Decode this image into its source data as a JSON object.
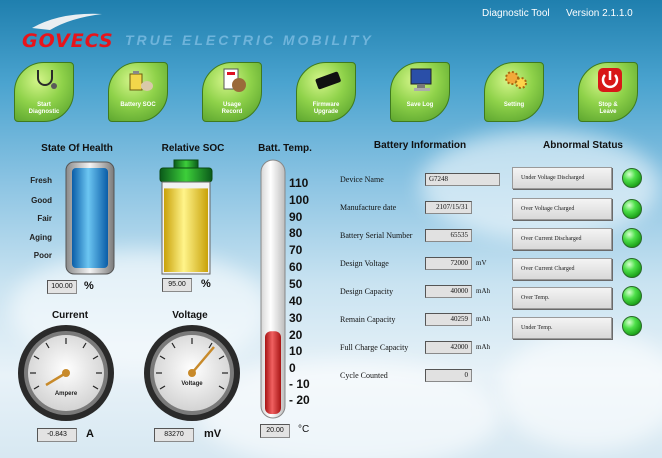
{
  "header": {
    "brand": "GOVECS",
    "tagline": "TRUE ELECTRIC MOBILITY",
    "app_title": "Diagnostic Tool",
    "version": "Version 2.1.1.0"
  },
  "nav": [
    {
      "label_line1": "Start",
      "label_line2": "Diagnostic",
      "icon": "stethoscope-icon"
    },
    {
      "label_line1": "Battery SOC",
      "label_line2": "",
      "icon": "battery-dog-icon"
    },
    {
      "label_line1": "Usage",
      "label_line2": "Record",
      "icon": "usage-record-icon"
    },
    {
      "label_line1": "Firmware",
      "label_line2": "Upgrade",
      "icon": "chip-icon"
    },
    {
      "label_line1": "Save Log",
      "label_line2": "",
      "icon": "computer-icon"
    },
    {
      "label_line1": "Setting",
      "label_line2": "",
      "icon": "gears-icon"
    },
    {
      "label_line1": "Stop &",
      "label_line2": "Leave",
      "icon": "power-icon"
    }
  ],
  "soh": {
    "title": "State Of Health",
    "levels": [
      "Fresh",
      "Good",
      "Fair",
      "Aging",
      "Poor"
    ],
    "value": "100.00",
    "unit": "%"
  },
  "soc": {
    "title": "Relative SOC",
    "value": "95.00",
    "unit": "%",
    "fill_fraction": 0.95
  },
  "temp": {
    "title": "Batt. Temp.",
    "scale": [
      "110",
      "100",
      "90",
      "80",
      "70",
      "60",
      "50",
      "40",
      "30",
      "20",
      "10",
      "0",
      "- 10",
      "- 20"
    ],
    "value": "20.00",
    "unit": "°C",
    "reading": 20
  },
  "current": {
    "title": "Current",
    "gauge_label": "Ampere",
    "value": "-0.843",
    "unit": "A"
  },
  "voltage": {
    "title": "Voltage",
    "gauge_label": "Voltage",
    "value": "83270",
    "unit": "mV"
  },
  "battery_info": {
    "title": "Battery Information",
    "rows": [
      {
        "label": "Device Name",
        "value": "G7248",
        "unit": ""
      },
      {
        "label": "Manufacture date",
        "value": "2107/15/31",
        "unit": ""
      },
      {
        "label": "Battery Serial Number",
        "value": "65535",
        "unit": ""
      },
      {
        "label": "Design Voltage",
        "value": "72000",
        "unit": "mV"
      },
      {
        "label": "Design Capacity",
        "value": "40000",
        "unit": "mAh"
      },
      {
        "label": "Remain Capacity",
        "value": "40259",
        "unit": "mAh"
      },
      {
        "label": "Full Charge Capacity",
        "value": "42000",
        "unit": "mAh"
      },
      {
        "label": "Cycle Counted",
        "value": "0",
        "unit": ""
      }
    ]
  },
  "abnormal": {
    "title": "Abnormal Status",
    "items": [
      {
        "label": "Under Voltage Discharged",
        "led_color": "#3fd43c"
      },
      {
        "label": "Over Voltage Charged",
        "led_color": "#3fd43c"
      },
      {
        "label": "Over Current Discharged",
        "led_color": "#3fd43c"
      },
      {
        "label": "Over Current Charged",
        "led_color": "#3fd43c"
      },
      {
        "label": "Over Temp.",
        "led_color": "#3fd43c"
      },
      {
        "label": "Under Temp.",
        "led_color": "#3fd43c"
      }
    ]
  },
  "colors": {
    "brand_red": "#e8141b",
    "nav_green": "#8fd24a",
    "status_green": "#3fd43c",
    "thermo_red": "#d82a2a"
  }
}
